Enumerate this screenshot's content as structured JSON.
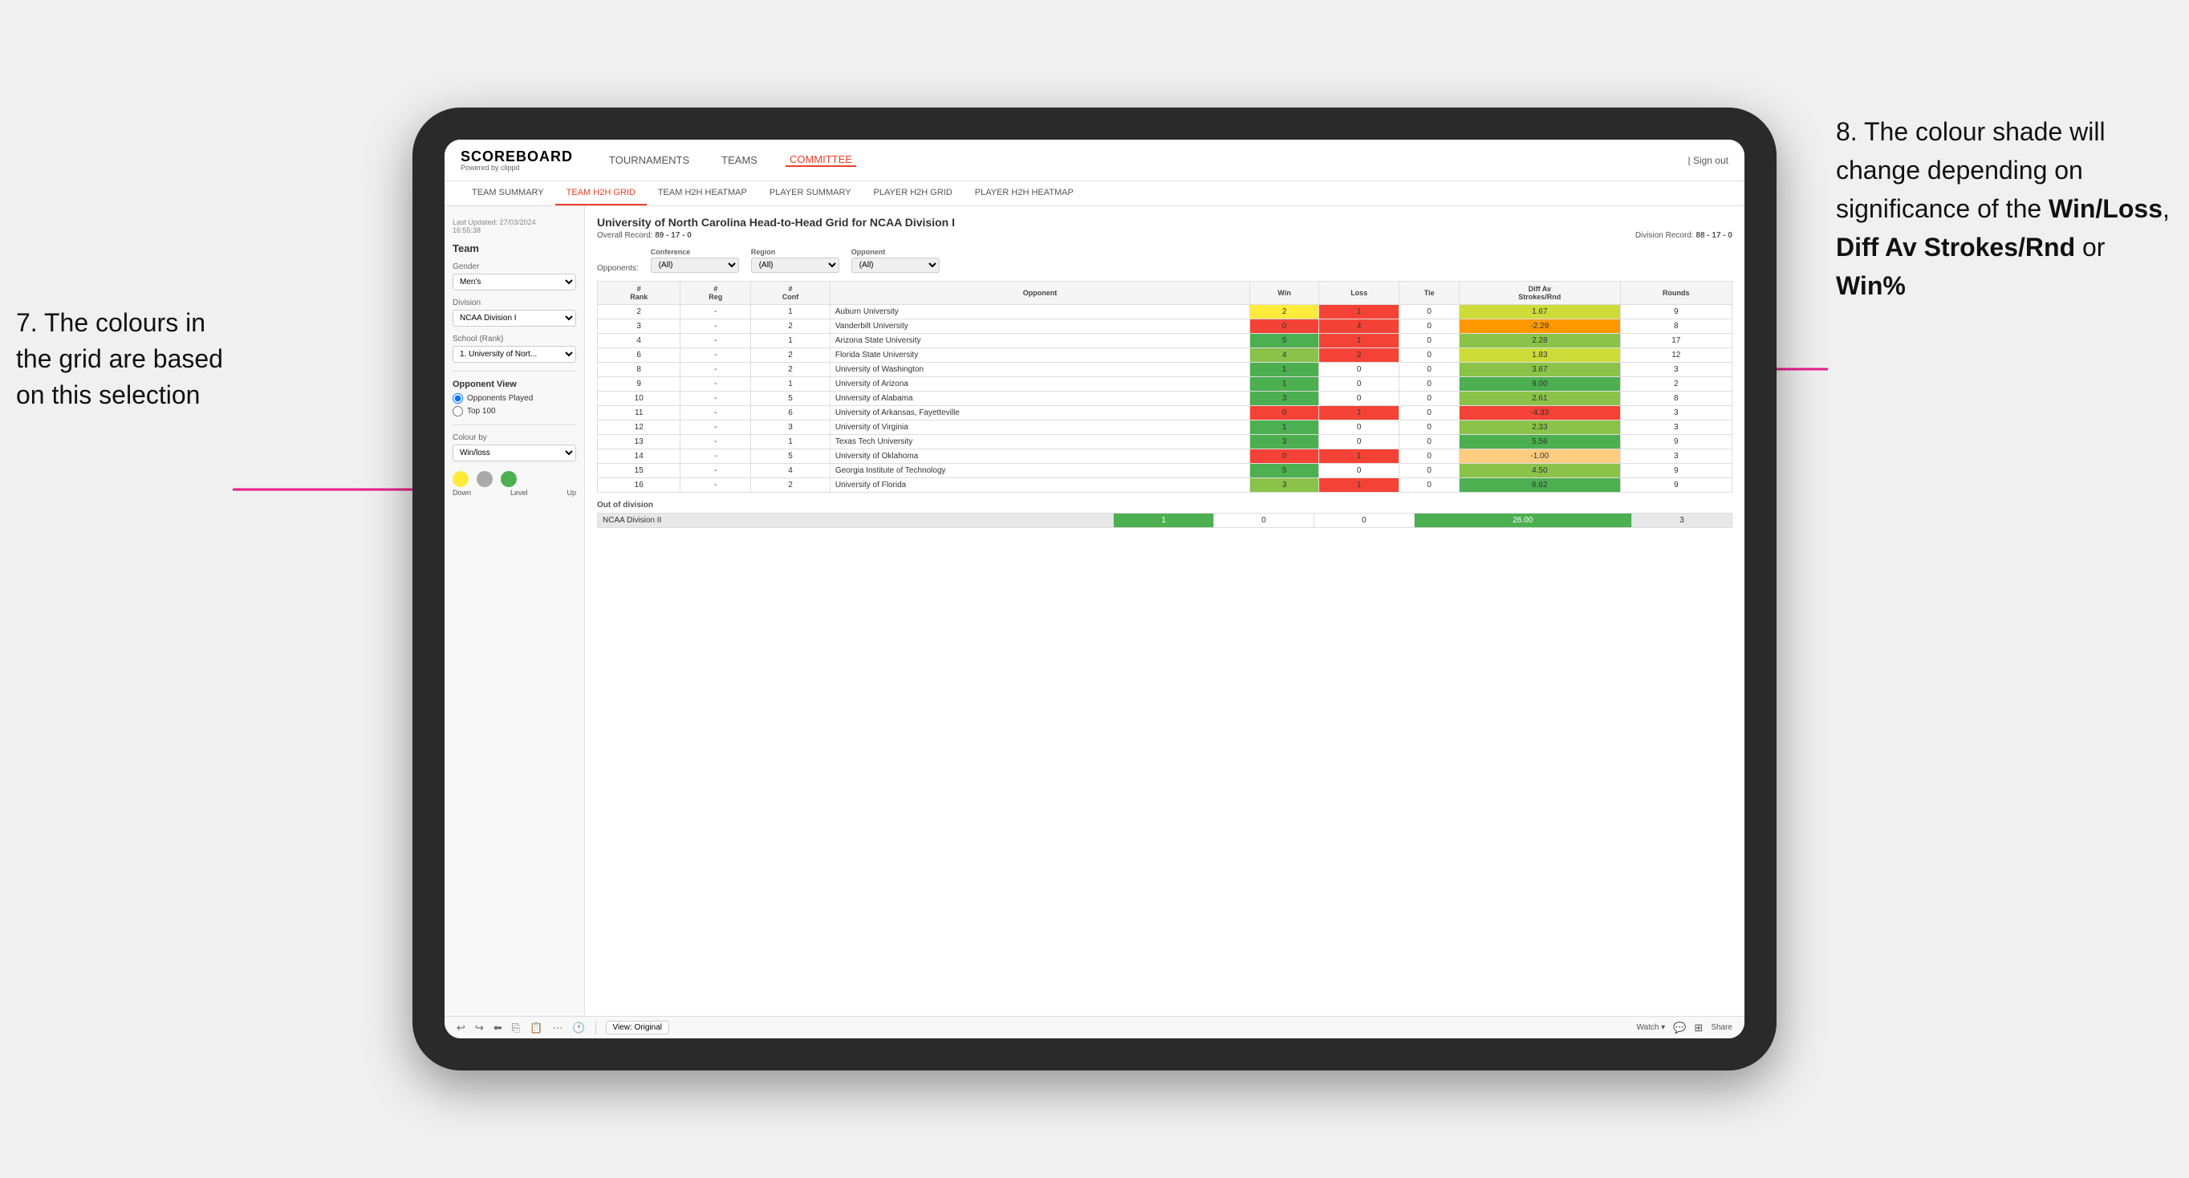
{
  "annotation_left": "7. The colours in the grid are based on this selection",
  "annotation_right_1": "8. The colour shade will change depending on significance of the ",
  "annotation_right_bold1": "Win/Loss",
  "annotation_right_2": ", ",
  "annotation_right_bold2": "Diff Av Strokes/Rnd",
  "annotation_right_3": " or ",
  "annotation_right_bold3": "Win%",
  "header": {
    "logo": "SCOREBOARD",
    "logo_sub": "Powered by clippd",
    "nav": [
      "TOURNAMENTS",
      "TEAMS",
      "COMMITTEE"
    ],
    "active_nav": "COMMITTEE",
    "sign_out": "Sign out"
  },
  "sub_nav": {
    "items": [
      "TEAM SUMMARY",
      "TEAM H2H GRID",
      "TEAM H2H HEATMAP",
      "PLAYER SUMMARY",
      "PLAYER H2H GRID",
      "PLAYER H2H HEATMAP"
    ],
    "active": "TEAM H2H GRID"
  },
  "sidebar": {
    "last_updated_label": "Last Updated: 27/03/2024",
    "last_updated_time": "16:55:38",
    "team_label": "Team",
    "gender_label": "Gender",
    "gender_value": "Men's",
    "division_label": "Division",
    "division_value": "NCAA Division I",
    "school_label": "School (Rank)",
    "school_value": "1. University of Nort...",
    "opponent_view_label": "Opponent View",
    "opponents_played": "Opponents Played",
    "top_100": "Top 100",
    "colour_by_label": "Colour by",
    "colour_by_value": "Win/loss",
    "colour_down": "Down",
    "colour_level": "Level",
    "colour_up": "Up"
  },
  "grid": {
    "title": "University of North Carolina Head-to-Head Grid for NCAA Division I",
    "overall_record_label": "Overall Record:",
    "overall_record": "89 - 17 - 0",
    "division_record_label": "Division Record:",
    "division_record": "88 - 17 - 0",
    "filters": {
      "opponents_label": "Opponents:",
      "conference_label": "Conference",
      "conference_value": "(All)",
      "region_label": "Region",
      "region_value": "(All)",
      "opponent_label": "Opponent",
      "opponent_value": "(All)"
    },
    "columns": [
      "#\nRank",
      "#\nReg",
      "#\nConf",
      "Opponent",
      "Win",
      "Loss",
      "Tie",
      "Diff Av\nStrokes/Rnd",
      "Rounds"
    ],
    "rows": [
      {
        "rank": "2",
        "reg": "-",
        "conf": "1",
        "opponent": "Auburn University",
        "win": "2",
        "loss": "1",
        "tie": "0",
        "diff": "1.67",
        "rounds": "9",
        "win_color": "yellow",
        "diff_color": "green_light"
      },
      {
        "rank": "3",
        "reg": "-",
        "conf": "2",
        "opponent": "Vanderbilt University",
        "win": "0",
        "loss": "4",
        "tie": "0",
        "diff": "-2.29",
        "rounds": "8",
        "win_color": "red",
        "diff_color": "orange"
      },
      {
        "rank": "4",
        "reg": "-",
        "conf": "1",
        "opponent": "Arizona State University",
        "win": "5",
        "loss": "1",
        "tie": "0",
        "diff": "2.28",
        "rounds": "17",
        "win_color": "green_dark",
        "diff_color": "green_mid"
      },
      {
        "rank": "6",
        "reg": "-",
        "conf": "2",
        "opponent": "Florida State University",
        "win": "4",
        "loss": "2",
        "tie": "0",
        "diff": "1.83",
        "rounds": "12",
        "win_color": "green_mid",
        "diff_color": "green_light"
      },
      {
        "rank": "8",
        "reg": "-",
        "conf": "2",
        "opponent": "University of Washington",
        "win": "1",
        "loss": "0",
        "tie": "0",
        "diff": "3.67",
        "rounds": "3",
        "win_color": "green_dark",
        "diff_color": "green_mid"
      },
      {
        "rank": "9",
        "reg": "-",
        "conf": "1",
        "opponent": "University of Arizona",
        "win": "1",
        "loss": "0",
        "tie": "0",
        "diff": "9.00",
        "rounds": "2",
        "win_color": "green_dark",
        "diff_color": "green_dark"
      },
      {
        "rank": "10",
        "reg": "-",
        "conf": "5",
        "opponent": "University of Alabama",
        "win": "3",
        "loss": "0",
        "tie": "0",
        "diff": "2.61",
        "rounds": "8",
        "win_color": "green_dark",
        "diff_color": "green_mid"
      },
      {
        "rank": "11",
        "reg": "-",
        "conf": "6",
        "opponent": "University of Arkansas, Fayetteville",
        "win": "0",
        "loss": "1",
        "tie": "0",
        "diff": "-4.33",
        "rounds": "3",
        "win_color": "red",
        "diff_color": "red"
      },
      {
        "rank": "12",
        "reg": "-",
        "conf": "3",
        "opponent": "University of Virginia",
        "win": "1",
        "loss": "0",
        "tie": "0",
        "diff": "2.33",
        "rounds": "3",
        "win_color": "green_dark",
        "diff_color": "green_mid"
      },
      {
        "rank": "13",
        "reg": "-",
        "conf": "1",
        "opponent": "Texas Tech University",
        "win": "3",
        "loss": "0",
        "tie": "0",
        "diff": "5.56",
        "rounds": "9",
        "win_color": "green_dark",
        "diff_color": "green_dark"
      },
      {
        "rank": "14",
        "reg": "-",
        "conf": "5",
        "opponent": "University of Oklahoma",
        "win": "0",
        "loss": "1",
        "tie": "0",
        "diff": "-1.00",
        "rounds": "3",
        "win_color": "red",
        "diff_color": "orange_light"
      },
      {
        "rank": "15",
        "reg": "-",
        "conf": "4",
        "opponent": "Georgia Institute of Technology",
        "win": "5",
        "loss": "0",
        "tie": "0",
        "diff": "4.50",
        "rounds": "9",
        "win_color": "green_dark",
        "diff_color": "green_mid"
      },
      {
        "rank": "16",
        "reg": "-",
        "conf": "2",
        "opponent": "University of Florida",
        "win": "3",
        "loss": "1",
        "tie": "0",
        "diff": "6.62",
        "rounds": "9",
        "win_color": "green_mid",
        "diff_color": "green_dark"
      }
    ],
    "out_of_division_label": "Out of division",
    "out_of_division_rows": [
      {
        "opponent": "NCAA Division II",
        "win": "1",
        "loss": "0",
        "tie": "0",
        "diff": "26.00",
        "rounds": "3"
      }
    ]
  },
  "toolbar": {
    "view_label": "View: Original",
    "watch_label": "Watch ▾",
    "share_label": "Share"
  }
}
